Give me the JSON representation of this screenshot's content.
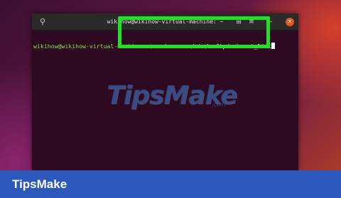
{
  "terminal": {
    "title": "wikihow@wikihow-virtual-machine: ~",
    "prompt_user": "wikihow@wikihow-virtual-machine",
    "prompt_path": ":~$ ",
    "command": "sudo nano /etc/vsftpd.chroot_list",
    "icons": {
      "search": "search-icon",
      "new_tab": "new-tab-icon",
      "menu": "hamburger-menu-icon",
      "minimize": "minimize-icon",
      "close": "close-icon"
    }
  },
  "watermark": {
    "text": "TipsMake",
    "suffix": ".com"
  },
  "footer": {
    "brand": "TipsMake"
  },
  "colors": {
    "highlight": "#22e022",
    "footer_bg": "#2b58ba",
    "prompt_user": "#8ae234",
    "prompt_path": "#729fcf",
    "terminal_bg": "#2d0922"
  }
}
